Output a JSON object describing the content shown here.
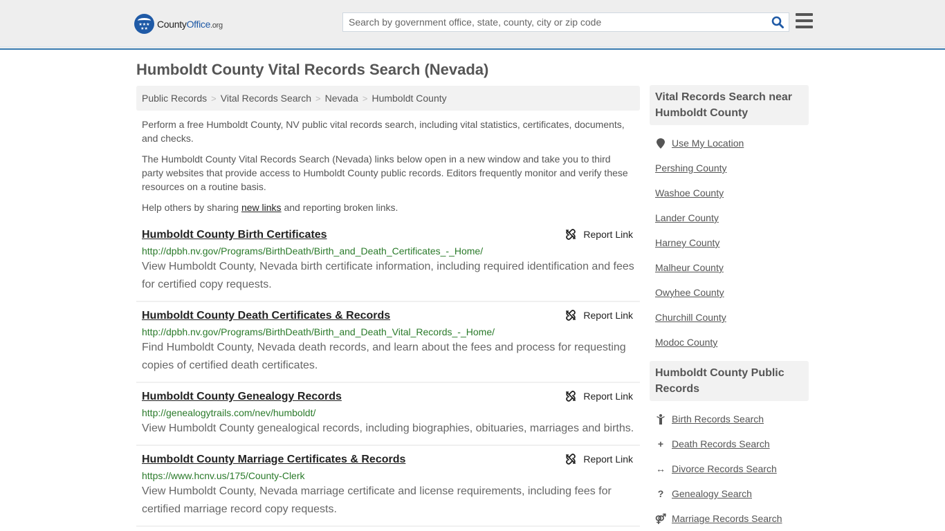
{
  "header": {
    "logo": {
      "name_part1": "County",
      "name_part2": "Office",
      "name_part3": ".org",
      "stars": "★★★\n★★"
    },
    "search": {
      "placeholder": "Search by government office, state, county, city or zip code",
      "value": ""
    },
    "colors": {
      "brand": "#1f5aa6",
      "accent_border": "#3a7bb0"
    }
  },
  "page": {
    "title": "Humboldt County Vital Records Search (Nevada)",
    "breadcrumb": [
      {
        "label": "Public Records"
      },
      {
        "label": "Vital Records Search"
      },
      {
        "label": "Nevada"
      },
      {
        "label": "Humboldt County"
      }
    ],
    "breadcrumb_separator": ">",
    "intro": {
      "p1": "Perform a free Humboldt County, NV public vital records search, including vital statistics, certificates, documents, and checks.",
      "p2": "The Humboldt County Vital Records Search (Nevada) links below open in a new window and take you to third party websites that provide access to Humboldt County public records. Editors frequently monitor and verify these resources on a routine basis.",
      "p3_before": "Help others by sharing ",
      "p3_link": "new links",
      "p3_after": " and reporting broken links."
    },
    "report_label": "Report Link",
    "results": [
      {
        "title": "Humboldt County Birth Certificates",
        "url": "http://dpbh.nv.gov/Programs/BirthDeath/Birth_and_Death_Certificates_-_Home/",
        "description": "View Humboldt County, Nevada birth certificate information, including required identification and fees for certified copy requests."
      },
      {
        "title": "Humboldt County Death Certificates & Records",
        "url": "http://dpbh.nv.gov/Programs/BirthDeath/Birth_and_Death_Vital_Records_-_Home/",
        "description": "Find Humboldt County, Nevada death records, and learn about the fees and process for requesting copies of certified death certificates."
      },
      {
        "title": "Humboldt County Genealogy Records",
        "url": "http://genealogytrails.com/nev/humboldt/",
        "description": "View Humboldt County genealogical records, including biographies, obituaries, marriages and births."
      },
      {
        "title": "Humboldt County Marriage Certificates & Records",
        "url": "https://www.hcnv.us/175/County-Clerk",
        "description": "View Humboldt County, Nevada marriage certificate and license requirements, including fees for certified marriage record copy requests."
      }
    ]
  },
  "sidebar": {
    "nearby": {
      "heading": "Vital Records Search near Humboldt County",
      "use_location": "Use My Location",
      "counties": [
        "Pershing County",
        "Washoe County",
        "Lander County",
        "Harney County",
        "Malheur County",
        "Owyhee County",
        "Churchill County",
        "Modoc County"
      ]
    },
    "public_records": {
      "heading": "Humboldt County Public Records",
      "items": [
        {
          "icon": "child-icon",
          "glyph": "🚸",
          "label": "Birth Records Search"
        },
        {
          "icon": "plus-icon",
          "glyph": "+",
          "label": "Death Records Search"
        },
        {
          "icon": "arrows-horizontal-icon",
          "glyph": "↔",
          "label": "Divorce Records Search"
        },
        {
          "icon": "question-icon",
          "glyph": "?",
          "label": "Genealogy Search"
        },
        {
          "icon": "marriage-icon",
          "glyph": "⚤",
          "label": "Marriage Records Search"
        }
      ]
    }
  }
}
